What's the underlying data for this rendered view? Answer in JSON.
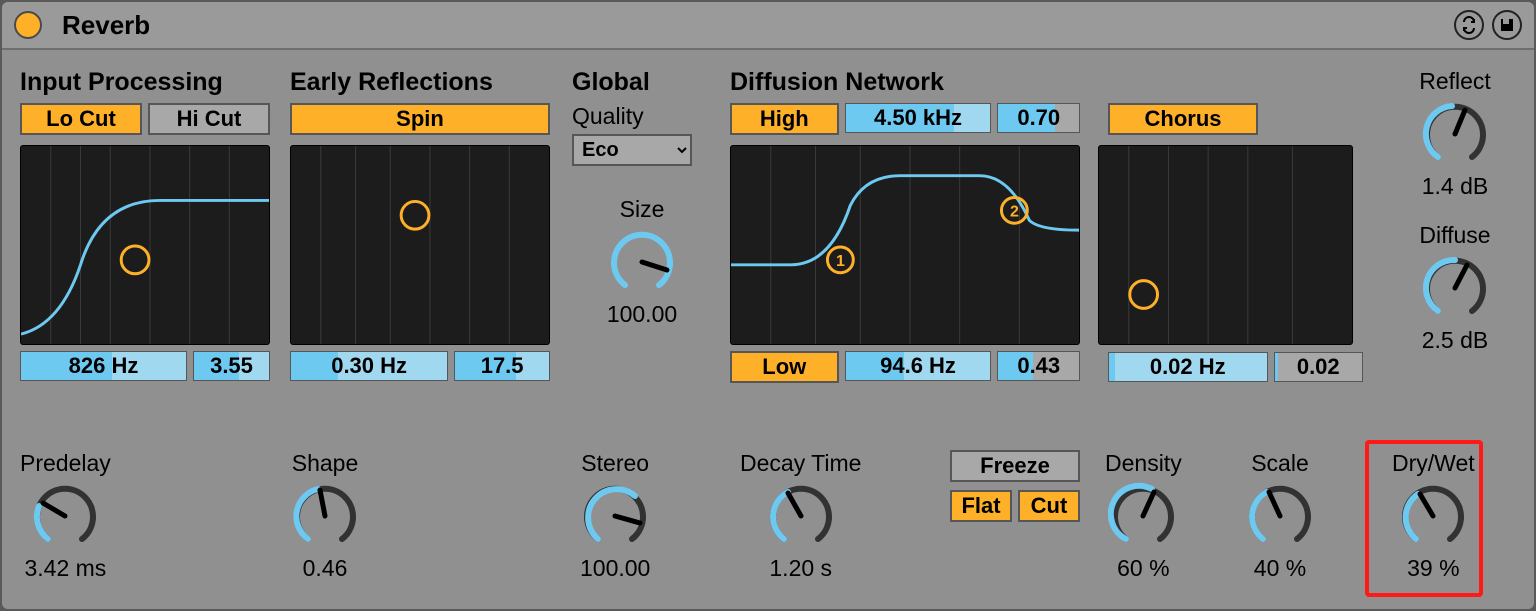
{
  "title": "Reverb",
  "input_processing": {
    "label": "Input Processing",
    "lo_cut": "Lo Cut",
    "hi_cut": "Hi Cut",
    "freq": "826 Hz",
    "width": "3.55"
  },
  "early_reflections": {
    "label": "Early Reflections",
    "spin": "Spin",
    "rate": "0.30 Hz",
    "amount": "17.5"
  },
  "global": {
    "label": "Global",
    "quality_label": "Quality",
    "quality_value": "Eco",
    "size_label": "Size",
    "size_value": "100.00"
  },
  "diffusion": {
    "label": "Diffusion Network",
    "high_btn": "High",
    "high_freq": "4.50 kHz",
    "high_amt": "0.70",
    "chorus_btn": "Chorus",
    "low_btn": "Low",
    "low_freq": "94.6 Hz",
    "low_amt": "0.43",
    "chorus_rate": "0.02 Hz",
    "chorus_amt": "0.02"
  },
  "right_knobs": {
    "reflect_label": "Reflect",
    "reflect_value": "1.4 dB",
    "diffuse_label": "Diffuse",
    "diffuse_value": "2.5 dB"
  },
  "bottom": {
    "predelay_label": "Predelay",
    "predelay_value": "3.42 ms",
    "shape_label": "Shape",
    "shape_value": "0.46",
    "stereo_label": "Stereo",
    "stereo_value": "100.00",
    "decay_label": "Decay Time",
    "decay_value": "1.20 s",
    "freeze_label": "Freeze",
    "flat_label": "Flat",
    "cut_label": "Cut",
    "density_label": "Density",
    "density_value": "60 %",
    "scale_label": "Scale",
    "scale_value": "40 %",
    "drywet_label": "Dry/Wet",
    "drywet_value": "39 %"
  }
}
